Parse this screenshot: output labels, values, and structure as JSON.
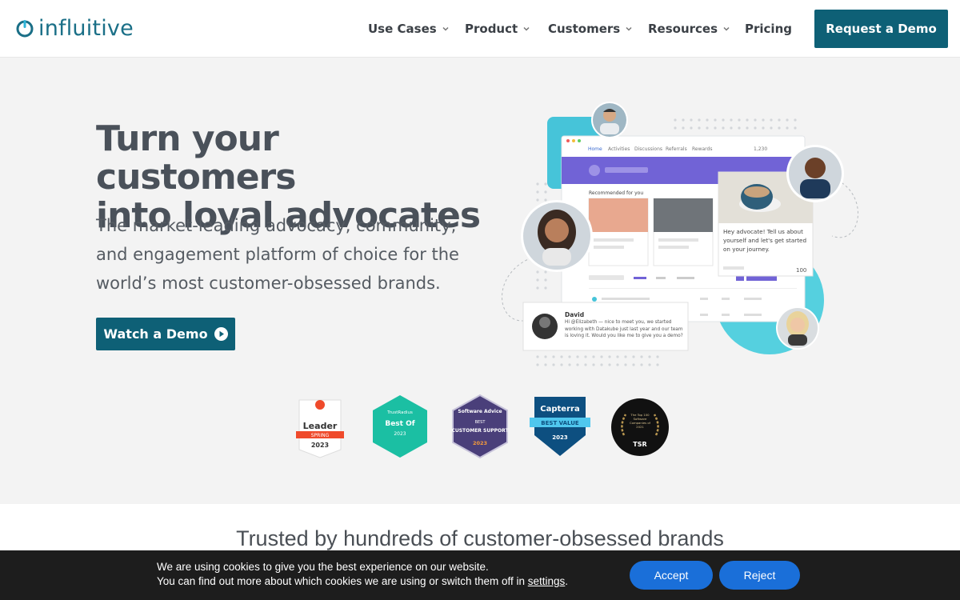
{
  "brand": {
    "name": "influitive",
    "color": "#1a6f87",
    "accent": "#0e6076"
  },
  "nav": {
    "items": [
      {
        "label": "Use Cases",
        "dropdown": true
      },
      {
        "label": "Product",
        "dropdown": true
      },
      {
        "label": "Customers",
        "dropdown": true
      },
      {
        "label": "Resources",
        "dropdown": true
      },
      {
        "label": "Pricing",
        "dropdown": false
      }
    ],
    "cta": "Request a Demo"
  },
  "hero": {
    "title_line1": "Turn your customers",
    "title_line2": "into loyal advocates",
    "subtitle": "The market-leading advocacy, community, and engagement platform of choice for the world’s most customer-obsessed brands.",
    "cta": "Watch a Demo"
  },
  "illustration": {
    "nav_tabs": [
      "Home",
      "Activities",
      "Discussions",
      "Referrals",
      "Rewards"
    ],
    "points": "1,230",
    "recommended_label": "Recommended for you",
    "advocate_card": "Hey advocate! Tell us about yourself and let's get started on your journey.",
    "advocate_points": "100",
    "chat_name": "David",
    "chat_message": "Hi @Elizabeth — nice to meet you, we started working with Datakube just last year and our team is loving it. Would you like me to give you a demo?"
  },
  "badges": [
    {
      "name": "g2-leader",
      "lines": [
        "Leader",
        "SPRING",
        "2023"
      ]
    },
    {
      "name": "trustradius-best-of",
      "lines": [
        "TrustRadius",
        "Best Of",
        "2023"
      ]
    },
    {
      "name": "software-advice",
      "lines": [
        "Software Advice",
        "BEST",
        "CUSTOMER SUPPORT",
        "2023"
      ]
    },
    {
      "name": "capterra-best-value",
      "lines": [
        "Capterra",
        "BEST VALUE",
        "2023"
      ]
    },
    {
      "name": "tsr-top-100",
      "lines": [
        "The Top 100 Software Companies of 2021",
        "TSR"
      ]
    }
  ],
  "trusted": {
    "heading": "Trusted by hundreds of customer-obsessed brands"
  },
  "cookie": {
    "line1": "We are using cookies to give you the best experience on our website.",
    "line2_prefix": "You can find out more about which cookies we are using or switch them off in ",
    "link": "settings",
    "line2_suffix": ".",
    "accept": "Accept",
    "reject": "Reject"
  }
}
